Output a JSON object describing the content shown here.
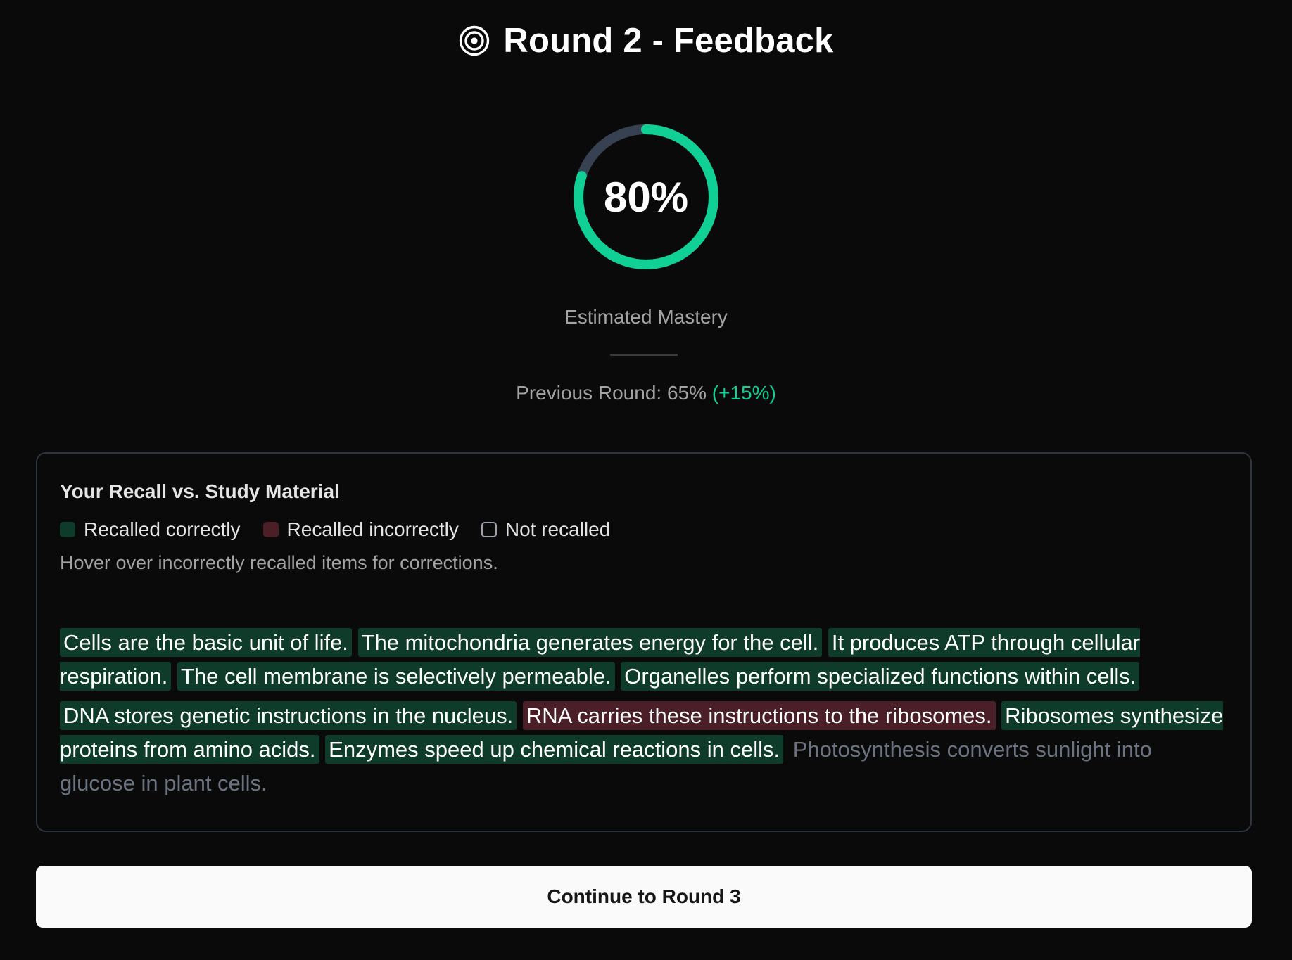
{
  "header": {
    "icon": "target-icon",
    "title": "Round 2 - Feedback"
  },
  "mastery": {
    "value_text": "80%",
    "progress": 0.8,
    "label": "Estimated Mastery",
    "previous_text": "Previous Round: 65%",
    "delta_text": "(+15%)",
    "colors": {
      "ring_progress": "#10d096",
      "ring_track": "#374151",
      "delta": "#10d096"
    }
  },
  "recall_card": {
    "title": "Your Recall vs. Study Material",
    "legend": {
      "correct": "Recalled correctly",
      "incorrect": "Recalled incorrectly",
      "not_recalled": "Not recalled"
    },
    "hint": "Hover over incorrectly recalled items for corrections.",
    "colors": {
      "correct_bg": "#0f3b2b",
      "incorrect_bg": "#4a1f28",
      "missing_text": "#6b7280"
    },
    "paragraphs": [
      [
        {
          "text": "Cells are the basic unit of life.",
          "status": "correct"
        },
        {
          "text": "The mitochondria generates energy for the cell.",
          "status": "correct"
        },
        {
          "text": "It produces ATP through cellular respiration.",
          "status": "correct"
        },
        {
          "text": "The cell membrane is selectively permeable.",
          "status": "correct"
        },
        {
          "text": "Organelles perform specialized functions within cells.",
          "status": "correct"
        }
      ],
      [
        {
          "text": "DNA stores genetic instructions in the nucleus.",
          "status": "correct"
        },
        {
          "text": "RNA carries these instructions to the ribosomes.",
          "status": "incorrect"
        },
        {
          "text": "Ribosomes synthesize proteins from amino acids.",
          "status": "correct"
        },
        {
          "text": "Enzymes speed up chemical reactions in cells.",
          "status": "correct"
        },
        {
          "text": "Photosynthesis converts sunlight into glucose in plant cells.",
          "status": "missing"
        }
      ]
    ]
  },
  "actions": {
    "continue_label": "Continue to Round 3"
  }
}
